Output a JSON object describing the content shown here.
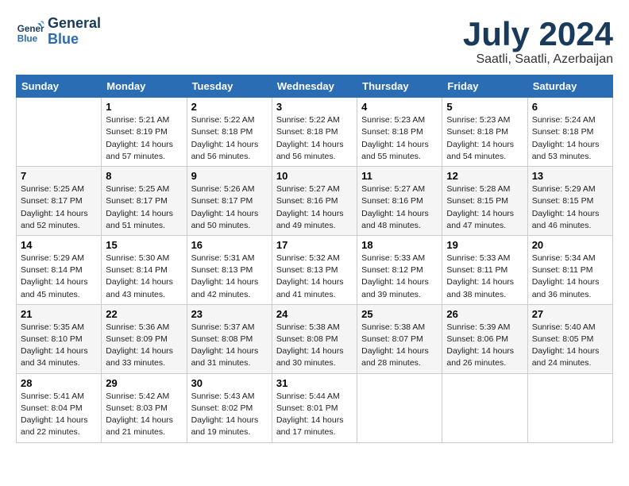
{
  "logo": {
    "line1": "General",
    "line2": "Blue"
  },
  "calendar": {
    "title": "July 2024",
    "subtitle": "Saatli, Saatli, Azerbaijan"
  },
  "headers": [
    "Sunday",
    "Monday",
    "Tuesday",
    "Wednesday",
    "Thursday",
    "Friday",
    "Saturday"
  ],
  "weeks": [
    [
      {
        "day": "",
        "sunrise": "",
        "sunset": "",
        "daylight": ""
      },
      {
        "day": "1",
        "sunrise": "Sunrise: 5:21 AM",
        "sunset": "Sunset: 8:19 PM",
        "daylight": "Daylight: 14 hours and 57 minutes."
      },
      {
        "day": "2",
        "sunrise": "Sunrise: 5:22 AM",
        "sunset": "Sunset: 8:18 PM",
        "daylight": "Daylight: 14 hours and 56 minutes."
      },
      {
        "day": "3",
        "sunrise": "Sunrise: 5:22 AM",
        "sunset": "Sunset: 8:18 PM",
        "daylight": "Daylight: 14 hours and 56 minutes."
      },
      {
        "day": "4",
        "sunrise": "Sunrise: 5:23 AM",
        "sunset": "Sunset: 8:18 PM",
        "daylight": "Daylight: 14 hours and 55 minutes."
      },
      {
        "day": "5",
        "sunrise": "Sunrise: 5:23 AM",
        "sunset": "Sunset: 8:18 PM",
        "daylight": "Daylight: 14 hours and 54 minutes."
      },
      {
        "day": "6",
        "sunrise": "Sunrise: 5:24 AM",
        "sunset": "Sunset: 8:18 PM",
        "daylight": "Daylight: 14 hours and 53 minutes."
      }
    ],
    [
      {
        "day": "7",
        "sunrise": "Sunrise: 5:25 AM",
        "sunset": "Sunset: 8:17 PM",
        "daylight": "Daylight: 14 hours and 52 minutes."
      },
      {
        "day": "8",
        "sunrise": "Sunrise: 5:25 AM",
        "sunset": "Sunset: 8:17 PM",
        "daylight": "Daylight: 14 hours and 51 minutes."
      },
      {
        "day": "9",
        "sunrise": "Sunrise: 5:26 AM",
        "sunset": "Sunset: 8:17 PM",
        "daylight": "Daylight: 14 hours and 50 minutes."
      },
      {
        "day": "10",
        "sunrise": "Sunrise: 5:27 AM",
        "sunset": "Sunset: 8:16 PM",
        "daylight": "Daylight: 14 hours and 49 minutes."
      },
      {
        "day": "11",
        "sunrise": "Sunrise: 5:27 AM",
        "sunset": "Sunset: 8:16 PM",
        "daylight": "Daylight: 14 hours and 48 minutes."
      },
      {
        "day": "12",
        "sunrise": "Sunrise: 5:28 AM",
        "sunset": "Sunset: 8:15 PM",
        "daylight": "Daylight: 14 hours and 47 minutes."
      },
      {
        "day": "13",
        "sunrise": "Sunrise: 5:29 AM",
        "sunset": "Sunset: 8:15 PM",
        "daylight": "Daylight: 14 hours and 46 minutes."
      }
    ],
    [
      {
        "day": "14",
        "sunrise": "Sunrise: 5:29 AM",
        "sunset": "Sunset: 8:14 PM",
        "daylight": "Daylight: 14 hours and 45 minutes."
      },
      {
        "day": "15",
        "sunrise": "Sunrise: 5:30 AM",
        "sunset": "Sunset: 8:14 PM",
        "daylight": "Daylight: 14 hours and 43 minutes."
      },
      {
        "day": "16",
        "sunrise": "Sunrise: 5:31 AM",
        "sunset": "Sunset: 8:13 PM",
        "daylight": "Daylight: 14 hours and 42 minutes."
      },
      {
        "day": "17",
        "sunrise": "Sunrise: 5:32 AM",
        "sunset": "Sunset: 8:13 PM",
        "daylight": "Daylight: 14 hours and 41 minutes."
      },
      {
        "day": "18",
        "sunrise": "Sunrise: 5:33 AM",
        "sunset": "Sunset: 8:12 PM",
        "daylight": "Daylight: 14 hours and 39 minutes."
      },
      {
        "day": "19",
        "sunrise": "Sunrise: 5:33 AM",
        "sunset": "Sunset: 8:11 PM",
        "daylight": "Daylight: 14 hours and 38 minutes."
      },
      {
        "day": "20",
        "sunrise": "Sunrise: 5:34 AM",
        "sunset": "Sunset: 8:11 PM",
        "daylight": "Daylight: 14 hours and 36 minutes."
      }
    ],
    [
      {
        "day": "21",
        "sunrise": "Sunrise: 5:35 AM",
        "sunset": "Sunset: 8:10 PM",
        "daylight": "Daylight: 14 hours and 34 minutes."
      },
      {
        "day": "22",
        "sunrise": "Sunrise: 5:36 AM",
        "sunset": "Sunset: 8:09 PM",
        "daylight": "Daylight: 14 hours and 33 minutes."
      },
      {
        "day": "23",
        "sunrise": "Sunrise: 5:37 AM",
        "sunset": "Sunset: 8:08 PM",
        "daylight": "Daylight: 14 hours and 31 minutes."
      },
      {
        "day": "24",
        "sunrise": "Sunrise: 5:38 AM",
        "sunset": "Sunset: 8:08 PM",
        "daylight": "Daylight: 14 hours and 30 minutes."
      },
      {
        "day": "25",
        "sunrise": "Sunrise: 5:38 AM",
        "sunset": "Sunset: 8:07 PM",
        "daylight": "Daylight: 14 hours and 28 minutes."
      },
      {
        "day": "26",
        "sunrise": "Sunrise: 5:39 AM",
        "sunset": "Sunset: 8:06 PM",
        "daylight": "Daylight: 14 hours and 26 minutes."
      },
      {
        "day": "27",
        "sunrise": "Sunrise: 5:40 AM",
        "sunset": "Sunset: 8:05 PM",
        "daylight": "Daylight: 14 hours and 24 minutes."
      }
    ],
    [
      {
        "day": "28",
        "sunrise": "Sunrise: 5:41 AM",
        "sunset": "Sunset: 8:04 PM",
        "daylight": "Daylight: 14 hours and 22 minutes."
      },
      {
        "day": "29",
        "sunrise": "Sunrise: 5:42 AM",
        "sunset": "Sunset: 8:03 PM",
        "daylight": "Daylight: 14 hours and 21 minutes."
      },
      {
        "day": "30",
        "sunrise": "Sunrise: 5:43 AM",
        "sunset": "Sunset: 8:02 PM",
        "daylight": "Daylight: 14 hours and 19 minutes."
      },
      {
        "day": "31",
        "sunrise": "Sunrise: 5:44 AM",
        "sunset": "Sunset: 8:01 PM",
        "daylight": "Daylight: 14 hours and 17 minutes."
      },
      {
        "day": "",
        "sunrise": "",
        "sunset": "",
        "daylight": ""
      },
      {
        "day": "",
        "sunrise": "",
        "sunset": "",
        "daylight": ""
      },
      {
        "day": "",
        "sunrise": "",
        "sunset": "",
        "daylight": ""
      }
    ]
  ]
}
